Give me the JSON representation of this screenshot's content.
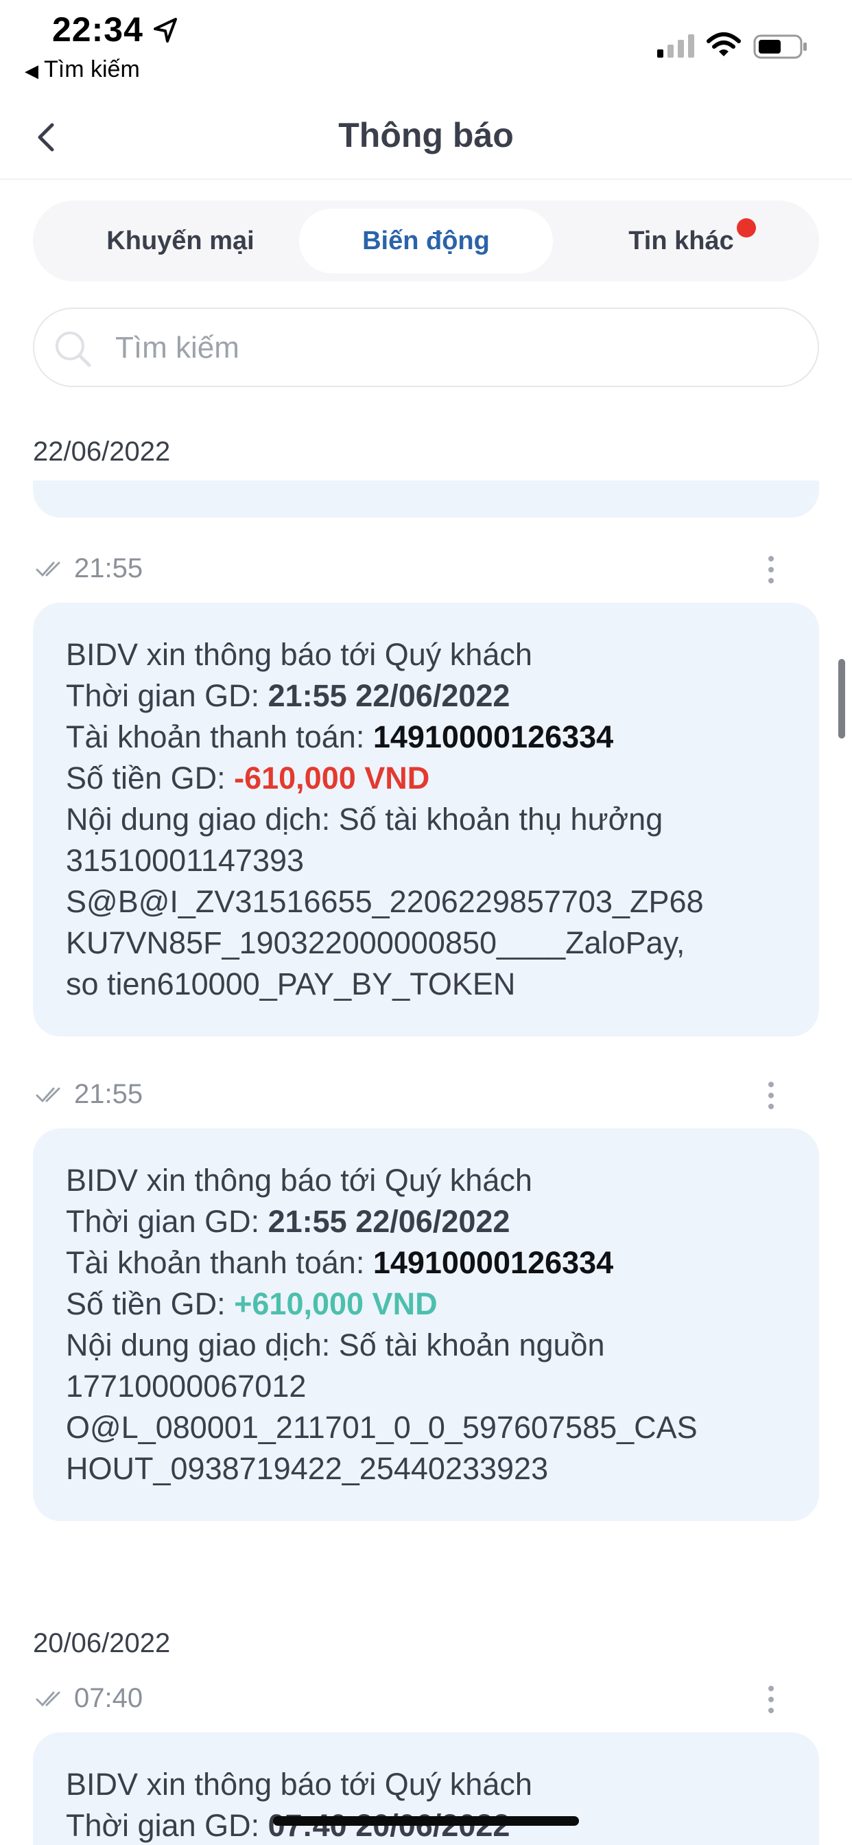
{
  "status_bar": {
    "time": "22:34",
    "back_app_label": "Tìm kiếm",
    "location_icon": "location-arrow-icon",
    "signal_icon": "cellular-signal-icon",
    "wifi_icon": "wifi-icon",
    "battery_icon": "battery-icon"
  },
  "header": {
    "title": "Thông báo",
    "back_icon": "chevron-left-icon"
  },
  "tabs": [
    {
      "label": "Khuyến mại",
      "active": false
    },
    {
      "label": "Biến động",
      "active": true
    },
    {
      "label": "Tin khác",
      "active": false,
      "has_badge": true
    }
  ],
  "search": {
    "placeholder": "Tìm kiếm",
    "value": ""
  },
  "groups": [
    {
      "date": "22/06/2022",
      "messages": [
        {
          "time": "21:55",
          "greeting": "BIDV xin thông báo tới Quý khách",
          "time_label": "Thời gian GD: ",
          "time_value": "21:55 22/06/2022",
          "account_label": "Tài khoản thanh toán: ",
          "account_value": "14910000126334",
          "amount_label": "Số tiền GD: ",
          "amount_value": "-610,000 VND",
          "content_lines": [
            "Nội dung giao dịch: Số tài khoản thụ hưởng",
            "31510001147393",
            "S@B@I_ZV31516655_2206229857703_ZP68",
            "KU7VN85F_190322000000850____ZaloPay,",
            "so tien610000_PAY_BY_TOKEN"
          ]
        },
        {
          "time": "21:55",
          "greeting": "BIDV xin thông báo tới Quý khách",
          "time_label": "Thời gian GD: ",
          "time_value": "21:55 22/06/2022",
          "account_label": "Tài khoản thanh toán: ",
          "account_value": "14910000126334",
          "amount_label": "Số tiền GD: ",
          "amount_value": "+610,000 VND",
          "content_lines": [
            "Nội dung giao dịch: Số tài khoản nguồn",
            "17710000067012",
            "O@L_080001_211701_0_0_597607585_CAS",
            "HOUT_0938719422_25440233923"
          ]
        }
      ]
    },
    {
      "date": "20/06/2022",
      "messages": [
        {
          "time": "07:40",
          "greeting": "BIDV xin thông báo tới Quý khách",
          "time_label": "Thời gian GD: ",
          "time_value": "07:40 20/06/2022"
        }
      ]
    }
  ],
  "colors": {
    "active_tab_text": "#2a63a9",
    "card_background": "#eef4fc",
    "negative_amount": "#e33a2f",
    "positive_amount": "#4dbfad",
    "badge": "#e8332a"
  }
}
